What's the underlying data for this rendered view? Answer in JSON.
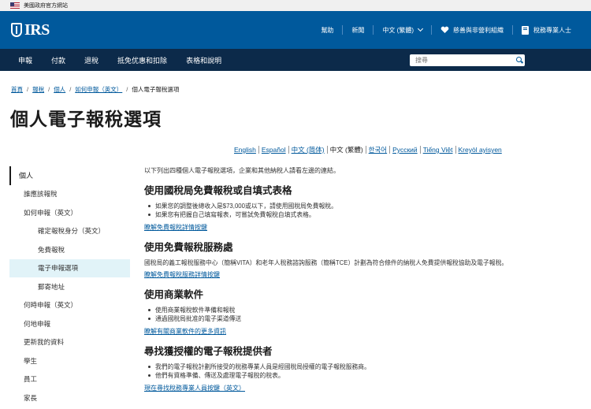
{
  "gov_banner": {
    "text": "美國政府官方網站"
  },
  "header": {
    "logo_text": "IRS",
    "links": [
      "幫助",
      "新聞",
      "中文 (繁體)",
      "慈善與非營利組織",
      "稅務專業人士"
    ]
  },
  "nav": {
    "items": [
      "申報",
      "付款",
      "退稅",
      "抵免优惠和扣除",
      "表格和說明"
    ],
    "search_placeholder": "搜尋"
  },
  "breadcrumb": [
    "首頁",
    "報稅",
    "個人",
    "如何申報（英文）",
    "個人電子報稅選項"
  ],
  "page_title": "個人電子報稅選項",
  "languages": [
    "English",
    "Español",
    "中文 (简体)",
    "中文 (繁體)",
    "한국어",
    "Русский",
    "Tiếng Việt",
    "Kreyòl ayisyen"
  ],
  "sidebar": {
    "items": [
      "個人",
      "誰應該報稅",
      "如何申報（英文）",
      "確定報稅身分（英文）",
      "免費報稅",
      "電子申報選項",
      "郵寄地址",
      "何時申報（英文）",
      "何地申報",
      "更新我的資料",
      "學生",
      "員工",
      "家長"
    ]
  },
  "main": {
    "intro": "以下列出四種個人電子報稅選項，企業和其他納稅人請看左邊的連結。",
    "sections": [
      {
        "title": "使用國稅局免費報稅或自填式表格",
        "bullets": [
          "如果您的調整後總收入是$73,000或以下，請使用國稅局免費報稅。",
          "如果您有把握自己填寫報表，可嘗試免費報稅自填式表格。"
        ],
        "link": "瞭解免費報稅詳情按鍵"
      },
      {
        "title": "使用免費報稅服務處",
        "paragraph": "國稅局的義工報稅服務中心（簡稱VITA）和老年人稅務諮詢服務（簡稱TCE）計劃為符合條件的納稅人免費提供報稅協助及電子報稅。",
        "link": "瞭解免費報稅服務詳情按鍵"
      },
      {
        "title": "使用商業軟件",
        "bullets": [
          "使用商業報稅軟件準備和報稅",
          "通過國稅局批准的電子渠道傳送"
        ],
        "link": "瞭解有關商業軟件的更多資訊"
      },
      {
        "title": "尋找獲授權的電子報稅提供者",
        "bullets": [
          "我們的電子報稅計劃所接受的稅務專業人員是經國稅局授權的電子報稅服務商。",
          "他們有資格準備、傳送及處理電子報稅的稅表。"
        ],
        "link": "現在尋找稅務專業人員按鍵（英文）"
      }
    ]
  },
  "colors": {
    "header_blue": "#00599c",
    "nav_dark": "#0c2a4a",
    "active_bg": "#e1f3f8",
    "link": "#00599c"
  }
}
